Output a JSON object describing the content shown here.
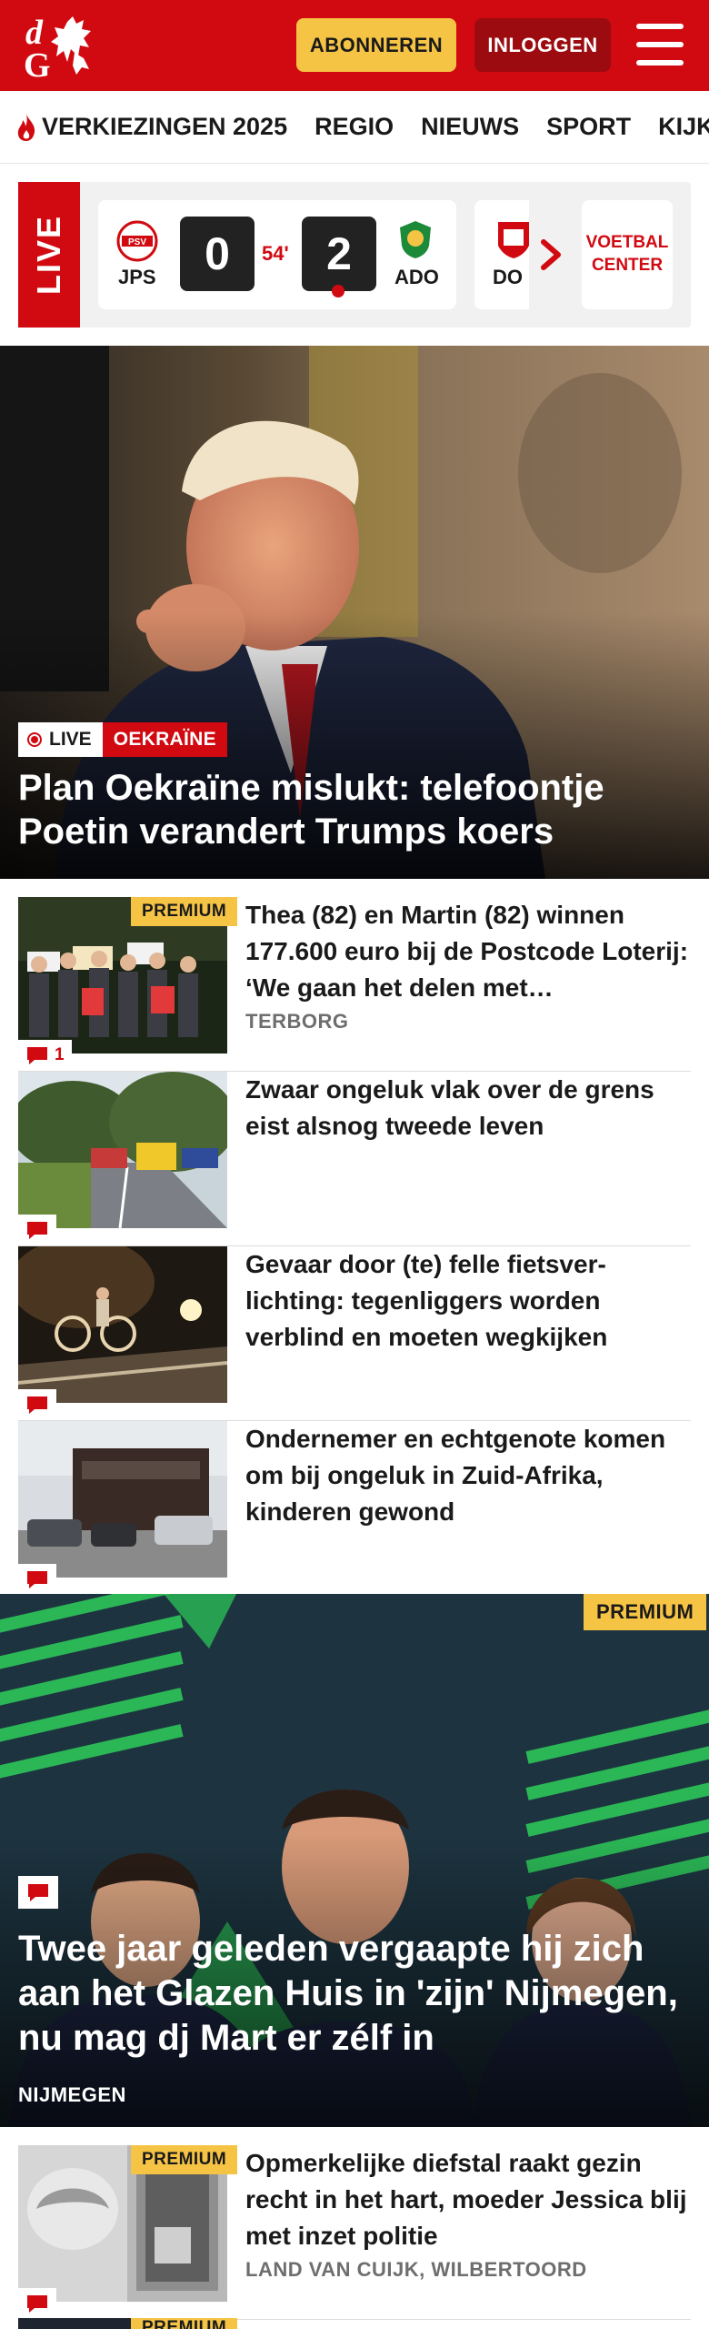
{
  "header": {
    "brand": "dG",
    "subscribe_label": "ABONNEREN",
    "login_label": "INLOGGEN",
    "colors": {
      "brand_red": "#d10a11",
      "dark_red": "#9c0b10",
      "yellow": "#f6c445"
    }
  },
  "nav": {
    "items": [
      {
        "label": "VERKIEZINGEN 2025",
        "icon": "flame-icon"
      },
      {
        "label": "REGIO"
      },
      {
        "label": "NIEUWS"
      },
      {
        "label": "SPORT"
      },
      {
        "label": "KIJK"
      }
    ]
  },
  "live": {
    "label": "LIVE",
    "match": {
      "home": "JPS",
      "home_score": "0",
      "away": "ADO",
      "away_score": "2",
      "minute": "54'"
    },
    "next_match_home": "DO",
    "voetbal_center": "VOETBAL CENTER"
  },
  "hero": {
    "live_tag": "LIVE",
    "category": "OEKRAÏNE",
    "title": "Plan Oekraïne mislukt: telefoontje Poetin verandert Trumps koers"
  },
  "articles": [
    {
      "premium": "PREMIUM",
      "comments": "1",
      "title": "Thea (82) en Martin (82) winnen 177.600 euro bij de Postcode Loterij: ‘We gaan het delen met…",
      "location": "TERBORG"
    },
    {
      "title": "Zwaar ongeluk vlak over de grens eist alsnog tweede leven"
    },
    {
      "title": "Gevaar door (te) felle fietsver-lichting: tegenliggers worden verblind en moeten wegkijken"
    },
    {
      "title": "Ondernemer en echtgenote komen om bij ongeluk in Zuid-Afrika, kinderen gewond"
    }
  ],
  "feature": {
    "premium": "PREMIUM",
    "title": "Twee jaar geleden vergaapte hij zich aan het Glazen Huis in 'zijn' Nijmegen, nu mag dj Mart er zélf in",
    "location": "NIJMEGEN"
  },
  "bottom_article": {
    "premium": "PREMIUM",
    "title": "Opmerkelijke diefstal raakt gezin recht in het hart, moeder Jessica blij met inzet politie",
    "location": "LAND VAN CUIJK, WILBERTOORD"
  },
  "peek_article": {
    "premium": "PREMIUM"
  }
}
